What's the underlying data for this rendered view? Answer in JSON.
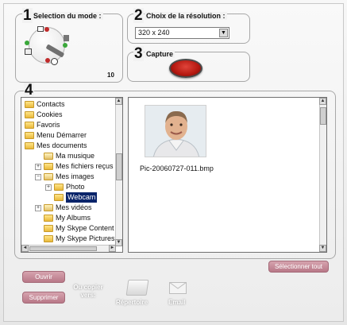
{
  "mode_panel": {
    "number": "1",
    "title": "Selection du mode :",
    "value": "10"
  },
  "resolution_panel": {
    "number": "2",
    "title": "Choix de la résolution :",
    "selected": "320 x 240"
  },
  "capture_panel": {
    "number": "3",
    "title": "Capture"
  },
  "browser_panel": {
    "number": "4"
  },
  "tree": {
    "items": [
      {
        "label": "Contacts",
        "icon": "folder-icon",
        "indent": 0,
        "expander": ""
      },
      {
        "label": "Cookies",
        "icon": "folder-icon",
        "indent": 0,
        "expander": ""
      },
      {
        "label": "Favoris",
        "icon": "folder-icon",
        "indent": 0,
        "expander": ""
      },
      {
        "label": "Menu Démarrer",
        "icon": "folder-icon",
        "indent": 0,
        "expander": ""
      },
      {
        "label": "Mes documents",
        "icon": "folder-icon",
        "indent": 0,
        "expander": ""
      },
      {
        "label": "Ma musique",
        "icon": "music-folder-icon",
        "indent": 1,
        "expander": ""
      },
      {
        "label": "Mes fichiers reçus",
        "icon": "folder-icon",
        "indent": 1,
        "expander": "+"
      },
      {
        "label": "Mes images",
        "icon": "pictures-folder-icon",
        "indent": 1,
        "expander": "−"
      },
      {
        "label": "Photo",
        "icon": "folder-icon",
        "indent": 2,
        "expander": "+"
      },
      {
        "label": "Webcam",
        "icon": "folder-icon",
        "indent": 2,
        "expander": "",
        "selected": true
      },
      {
        "label": "Mes vidéos",
        "icon": "video-folder-icon",
        "indent": 1,
        "expander": "+"
      },
      {
        "label": "My Albums",
        "icon": "folder-icon",
        "indent": 1,
        "expander": ""
      },
      {
        "label": "My Skype Content",
        "icon": "folder-icon",
        "indent": 1,
        "expander": ""
      },
      {
        "label": "My Skype Pictures",
        "icon": "folder-icon",
        "indent": 1,
        "expander": ""
      }
    ]
  },
  "preview": {
    "filename": "Pic-20060727-011.bmp"
  },
  "buttons": {
    "select_all": "Sélectionner tout",
    "open": "Ouvrir",
    "delete": "Supprimer",
    "copy_to": "Ou copier vers:",
    "directory": "Répertoire",
    "email": "Email"
  },
  "colors": {
    "accent_button": "#b87887",
    "selection": "#0a246a",
    "capture_red": "#c0201a"
  }
}
